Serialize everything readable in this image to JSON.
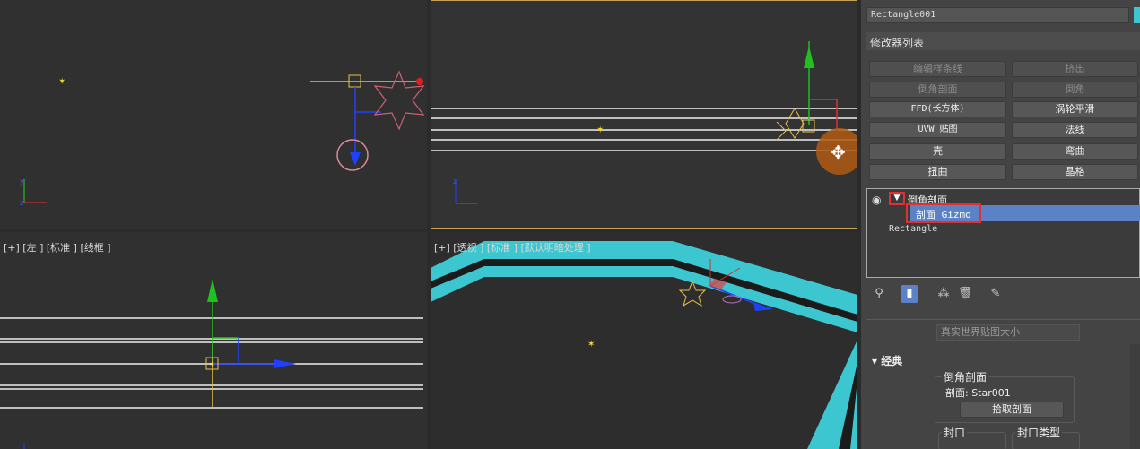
{
  "viewports": {
    "top_left": {
      "label": ""
    },
    "top_right": {
      "label": ""
    },
    "bottom_left": {
      "label": "[+] [左 ] [标准 ] [线框 ]"
    },
    "bottom_right": {
      "label": "[+] [透视 ] [标准 ] [默认明暗处理 ]"
    }
  },
  "panel": {
    "object_name": "Rectangle001",
    "object_color": "#3cc7d0",
    "modifier_list_label": "修改器列表",
    "modifier_buttons": [
      {
        "label": "编辑样条线",
        "enabled": false
      },
      {
        "label": "挤出",
        "enabled": false
      },
      {
        "label": "倒角剖面",
        "enabled": false
      },
      {
        "label": "倒角",
        "enabled": false
      },
      {
        "label": "FFD(长方体)",
        "enabled": true
      },
      {
        "label": "涡轮平滑",
        "enabled": true
      },
      {
        "label": "UVW 贴图",
        "enabled": true
      },
      {
        "label": "法线",
        "enabled": true
      },
      {
        "label": "壳",
        "enabled": true
      },
      {
        "label": "弯曲",
        "enabled": true
      },
      {
        "label": "扭曲",
        "enabled": true
      },
      {
        "label": "晶格",
        "enabled": true
      }
    ],
    "stack": {
      "modifier": "倒角剖面",
      "expand_symbol": "▼",
      "sub_object": "剖面 Gizmo",
      "base_object": "Rectangle"
    },
    "real_world_map": "真实世界贴图大小",
    "section_classic": "经典",
    "bevel_group": {
      "title": "倒角剖面",
      "profile_label": "剖面: Star001",
      "pick_button": "拾取剖面"
    },
    "cap_group_title": "封口",
    "cap_type_group_title": "封口类型",
    "accent_color": "#5b82c6",
    "highlight_color": "#e03030"
  }
}
